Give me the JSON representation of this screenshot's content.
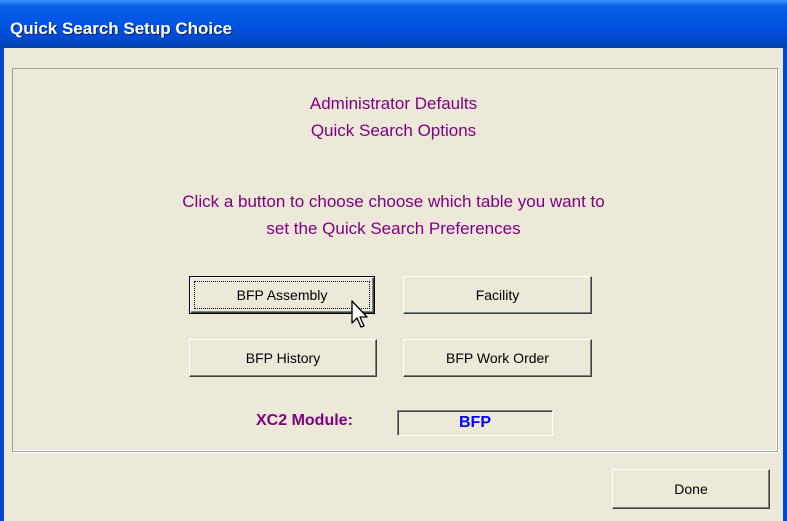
{
  "window": {
    "title": "Quick Search Setup Choice"
  },
  "header": {
    "line1": "Administrator Defaults",
    "line2": "Quick Search Options"
  },
  "instructions": {
    "line1": "Click a button to choose choose which table you want to",
    "line2": "set the Quick Search Preferences"
  },
  "buttons": {
    "assembly": "BFP Assembly",
    "facility": "Facility",
    "history": "BFP History",
    "work_order": "BFP Work Order",
    "done": "Done"
  },
  "module": {
    "label": "XC2 Module:",
    "value": "BFP"
  },
  "colors": {
    "heading_text": "#800080",
    "module_value": "#0000ff",
    "titlebar": "#0054e3",
    "background": "#ece9d8"
  },
  "icons": {
    "cursor": "arrow-cursor-icon"
  }
}
